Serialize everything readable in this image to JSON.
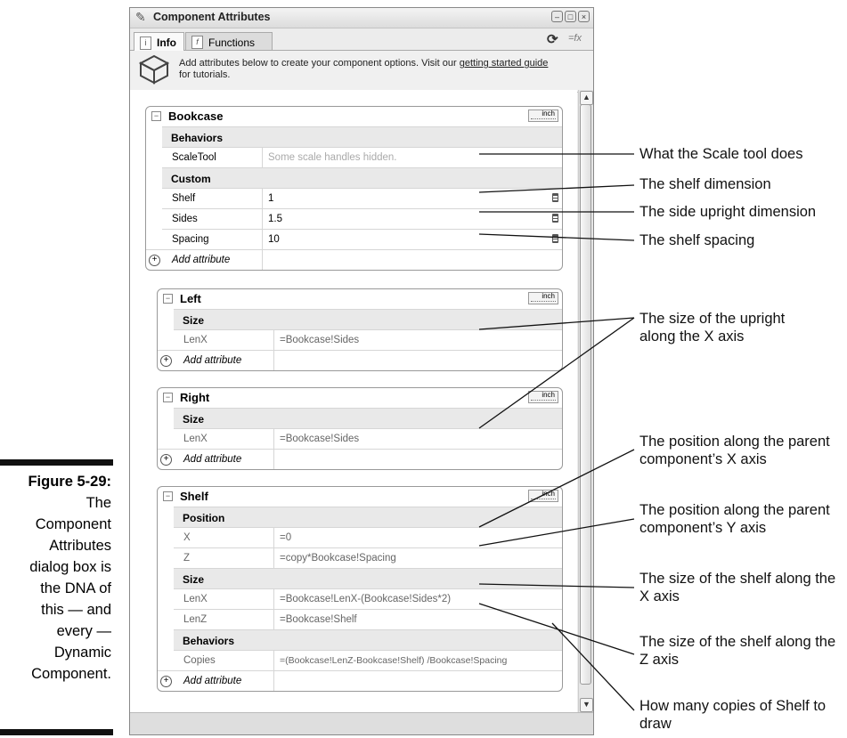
{
  "caption": {
    "figure": "Figure 5-29:",
    "text": [
      "The",
      "Component",
      "Attributes",
      "dialog box is",
      "the DNA of",
      "this — and",
      "every —",
      "Dynamic",
      "Component."
    ]
  },
  "window": {
    "title": "Component Attributes",
    "tabs": [
      {
        "label": "Info"
      },
      {
        "label": "Functions"
      }
    ],
    "info_text": "Add attributes below to create your component options. Visit our",
    "info_link": "getting started guide",
    "info_text_after": "for tutorials."
  },
  "components": [
    {
      "name": "Bookcase",
      "unit": "inch",
      "rows": [
        {
          "type": "group",
          "label": "Behaviors"
        },
        {
          "type": "attr",
          "key": "ScaleTool",
          "value": "Some scale handles hidden.",
          "muted": true
        },
        {
          "type": "group",
          "label": "Custom"
        },
        {
          "type": "attr",
          "key": "Shelf",
          "value": "1",
          "calc": true
        },
        {
          "type": "attr",
          "key": "Sides",
          "value": "1.5",
          "calc": true
        },
        {
          "type": "attr",
          "key": "Spacing",
          "value": "10",
          "calc": true
        },
        {
          "type": "add",
          "label": "Add attribute"
        }
      ]
    },
    {
      "name": "Left",
      "unit": "inch",
      "rows": [
        {
          "type": "group",
          "label": "Size"
        },
        {
          "type": "attr",
          "key": "LenX",
          "value": "=Bookcase!Sides"
        },
        {
          "type": "add",
          "label": "Add attribute"
        }
      ]
    },
    {
      "name": "Right",
      "unit": "inch",
      "rows": [
        {
          "type": "group",
          "label": "Size"
        },
        {
          "type": "attr",
          "key": "LenX",
          "value": "=Bookcase!Sides"
        },
        {
          "type": "add",
          "label": "Add attribute"
        }
      ]
    },
    {
      "name": "Shelf",
      "unit": "inch",
      "rows": [
        {
          "type": "group",
          "label": "Position"
        },
        {
          "type": "attr",
          "key": "X",
          "value": "=0"
        },
        {
          "type": "attr",
          "key": "Z",
          "value": "=copy*Bookcase!Spacing"
        },
        {
          "type": "group",
          "label": "Size"
        },
        {
          "type": "attr",
          "key": "LenX",
          "value": "=Bookcase!LenX-(Bookcase!Sides*2)"
        },
        {
          "type": "attr",
          "key": "LenZ",
          "value": "=Bookcase!Shelf"
        },
        {
          "type": "group",
          "label": "Behaviors"
        },
        {
          "type": "attr",
          "key": "Copies",
          "value": "=(Bookcase!LenZ-Bookcase!Shelf) /Bookcase!Spacing"
        },
        {
          "type": "add",
          "label": "Add attribute"
        }
      ]
    }
  ],
  "annotations": [
    "What the Scale tool does",
    "The shelf dimension",
    "The side upright dimension",
    "The shelf spacing",
    "The size of the upright along the X axis",
    "The position along the parent component’s X axis",
    "The position along the parent component’s Y axis",
    "The size of the shelf along the X axis",
    "The size of the shelf along the Z axis",
    "How many copies of Shelf to draw"
  ]
}
